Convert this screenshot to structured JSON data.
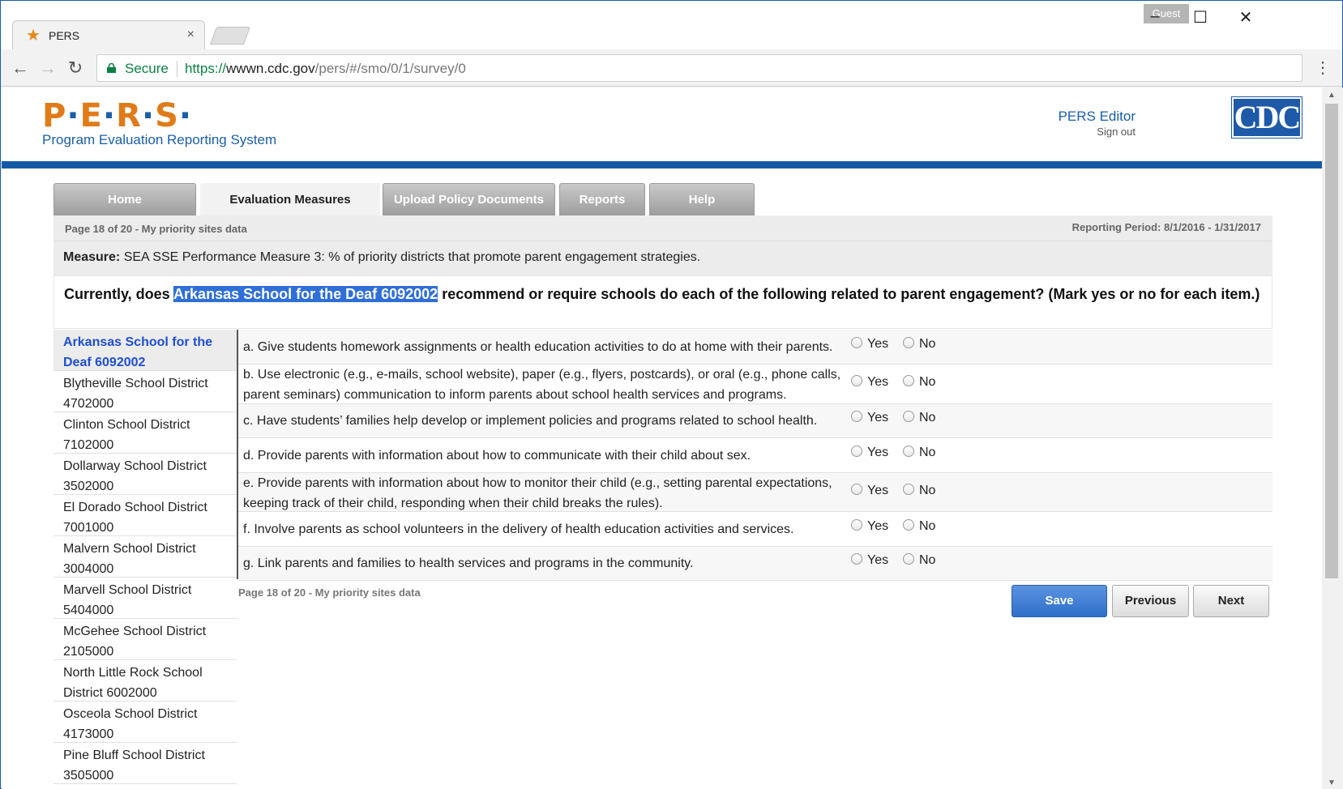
{
  "browser": {
    "tab_title": "PERS",
    "tab_close": "×",
    "profile": "Guest",
    "secure_label": "Secure",
    "url_scheme": "https://",
    "url_host": "wwwn.cdc.gov",
    "url_path": "/pers/#/smo/0/1/survey/0"
  },
  "header": {
    "logo_text": [
      "P",
      "E",
      "R",
      "S"
    ],
    "logo_subtitle": "Program Evaluation Reporting System",
    "user_role": "PERS Editor",
    "signout": "Sign out",
    "agency_logo": "CDC"
  },
  "nav": {
    "tabs": [
      {
        "label": "Home",
        "active": false
      },
      {
        "label": "Evaluation Measures Reporting",
        "active": true
      },
      {
        "label": "Upload Policy Documents",
        "active": false
      },
      {
        "label": "Reports",
        "active": false
      },
      {
        "label": "Help",
        "active": false
      }
    ]
  },
  "survey": {
    "page_label": "Page 18 of 20 - My priority sites data",
    "reporting_period": "Reporting Period: 8/1/2016 - 1/31/2017",
    "measure_label": "Measure:",
    "measure_text": "SEA SSE Performance Measure 3: % of priority districts that promote parent engagement strategies.",
    "question_prefix": "Currently, does",
    "question_site": "Arkansas School for the Deaf 6092002",
    "question_suffix": "recommend or require schools do each of the following related to parent engagement? (Mark yes or no for each item.)",
    "yes_label": "Yes",
    "no_label": "No",
    "footer_page_label": "Page 18 of 20 - My priority sites data",
    "save_label": "Save",
    "previous_label": "Previous",
    "next_label": "Next"
  },
  "sites": [
    {
      "line1": "Arkansas School for the",
      "line2": "Deaf 6092002",
      "active": true
    },
    {
      "line1": "Blytheville School District",
      "line2": "4702000",
      "active": false
    },
    {
      "line1": "Clinton School District",
      "line2": "7102000",
      "active": false
    },
    {
      "line1": "Dollarway School District",
      "line2": "3502000",
      "active": false
    },
    {
      "line1": "El Dorado School District",
      "line2": "7001000",
      "active": false
    },
    {
      "line1": "Malvern School District",
      "line2": "3004000",
      "active": false
    },
    {
      "line1": "Marvell School District",
      "line2": "5404000",
      "active": false
    },
    {
      "line1": "McGehee School District",
      "line2": "2105000",
      "active": false
    },
    {
      "line1": "North Little Rock School",
      "line2": "District 6002000",
      "active": false
    },
    {
      "line1": "Osceola School District",
      "line2": "4173000",
      "active": false
    },
    {
      "line1": "Pine Bluff School District",
      "line2": "3505000",
      "active": false
    }
  ],
  "items": [
    {
      "text": "a. Give students homework assignments or health education activities to do at home with their parents."
    },
    {
      "text": "b. Use electronic (e.g., e-mails, school website), paper (e.g., flyers, postcards), or oral (e.g., phone calls, parent seminars) communication to inform parents about school health services and programs."
    },
    {
      "text": "c. Have students’ families help develop or implement policies and programs related to school health."
    },
    {
      "text": "d. Provide parents with information about how to communicate with their child about sex."
    },
    {
      "text": "e. Provide parents with information about how to monitor their child (e.g., setting parental expectations, keeping track of their child, responding when their child breaks the rules)."
    },
    {
      "text": "f. Involve parents as school volunteers in the delivery of health education activities and services."
    },
    {
      "text": "g. Link parents and families to health services and programs in the community."
    }
  ]
}
